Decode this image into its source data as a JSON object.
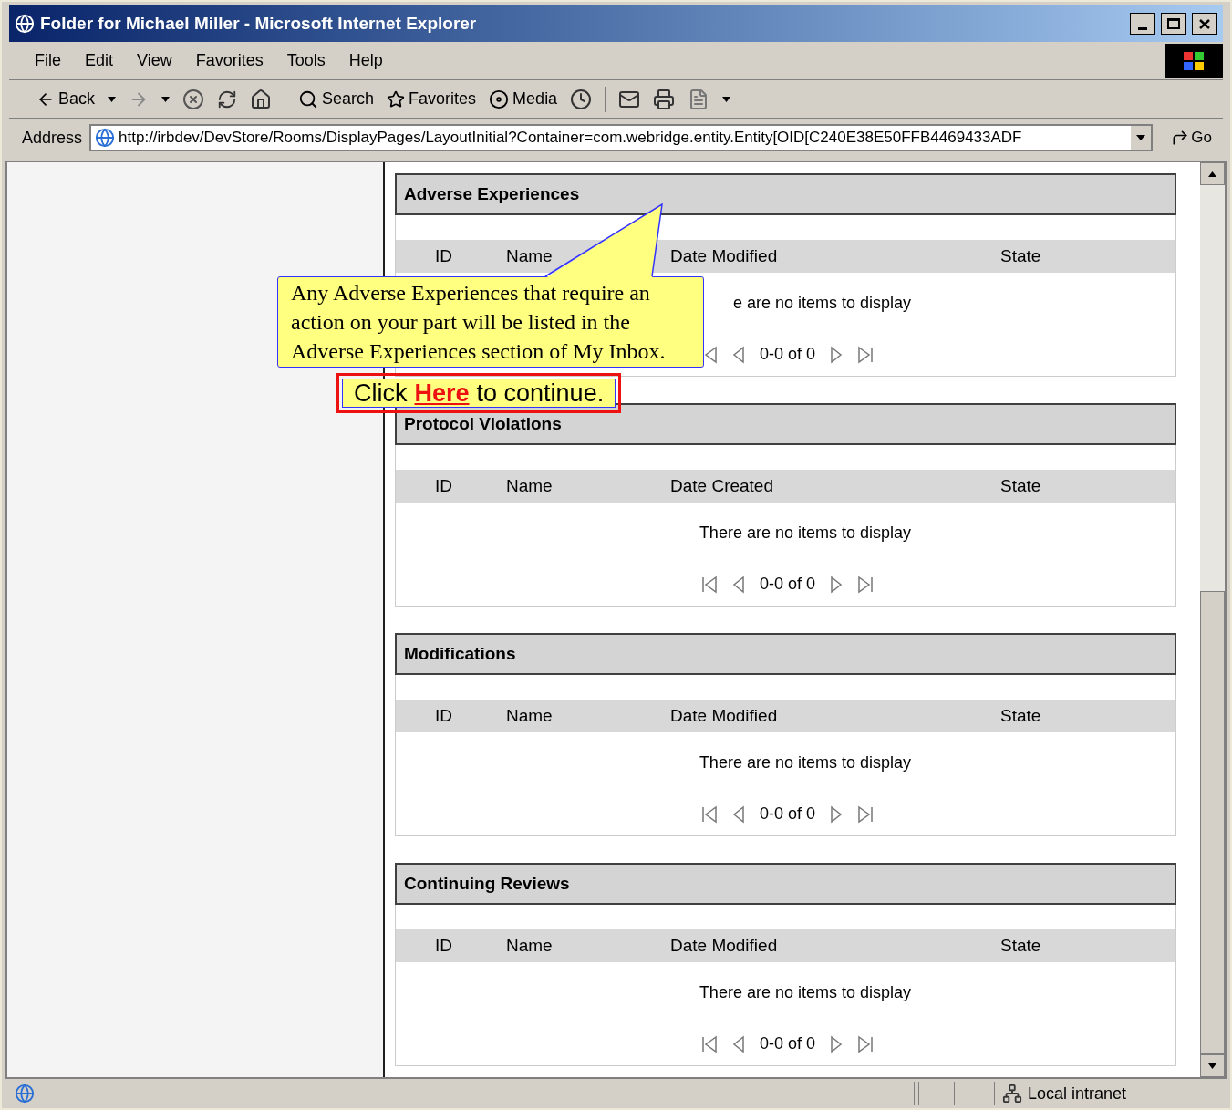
{
  "window": {
    "title": "Folder for Michael Miller - Microsoft Internet Explorer"
  },
  "menu": [
    "File",
    "Edit",
    "View",
    "Favorites",
    "Tools",
    "Help"
  ],
  "toolbar": {
    "back": "Back",
    "search": "Search",
    "favorites": "Favorites",
    "media": "Media"
  },
  "address_bar": {
    "label": "Address",
    "url": "http://irbdev/DevStore/Rooms/DisplayPages/LayoutInitial?Container=com.webridge.entity.Entity[OID[C240E38E50FFB4469433ADF",
    "go": "Go"
  },
  "sections": [
    {
      "title": "Adverse Experiences",
      "columns": [
        "ID",
        "Name",
        "Date Modified",
        "State"
      ],
      "empty_message": "e are no items to display",
      "pager": "0-0 of 0"
    },
    {
      "title": "Protocol Violations",
      "columns": [
        "ID",
        "Name",
        "Date Created",
        "State"
      ],
      "empty_message": "There are no items to display",
      "pager": "0-0 of 0"
    },
    {
      "title": "Modifications",
      "columns": [
        "ID",
        "Name",
        "Date Modified",
        "State"
      ],
      "empty_message": "There are no items to display",
      "pager": "0-0 of 0"
    },
    {
      "title": "Continuing Reviews",
      "columns": [
        "ID",
        "Name",
        "Date Modified",
        "State"
      ],
      "empty_message": "There are no items to display",
      "pager": "0-0 of 0"
    }
  ],
  "callout": {
    "text": "Any Adverse Experiences that require an action on your part will be listed in the Adverse Experiences section of My Inbox."
  },
  "continue_prompt": {
    "before": "Click",
    "link": "Here",
    "after": "to continue."
  },
  "status_bar": {
    "zone": "Local intranet"
  }
}
